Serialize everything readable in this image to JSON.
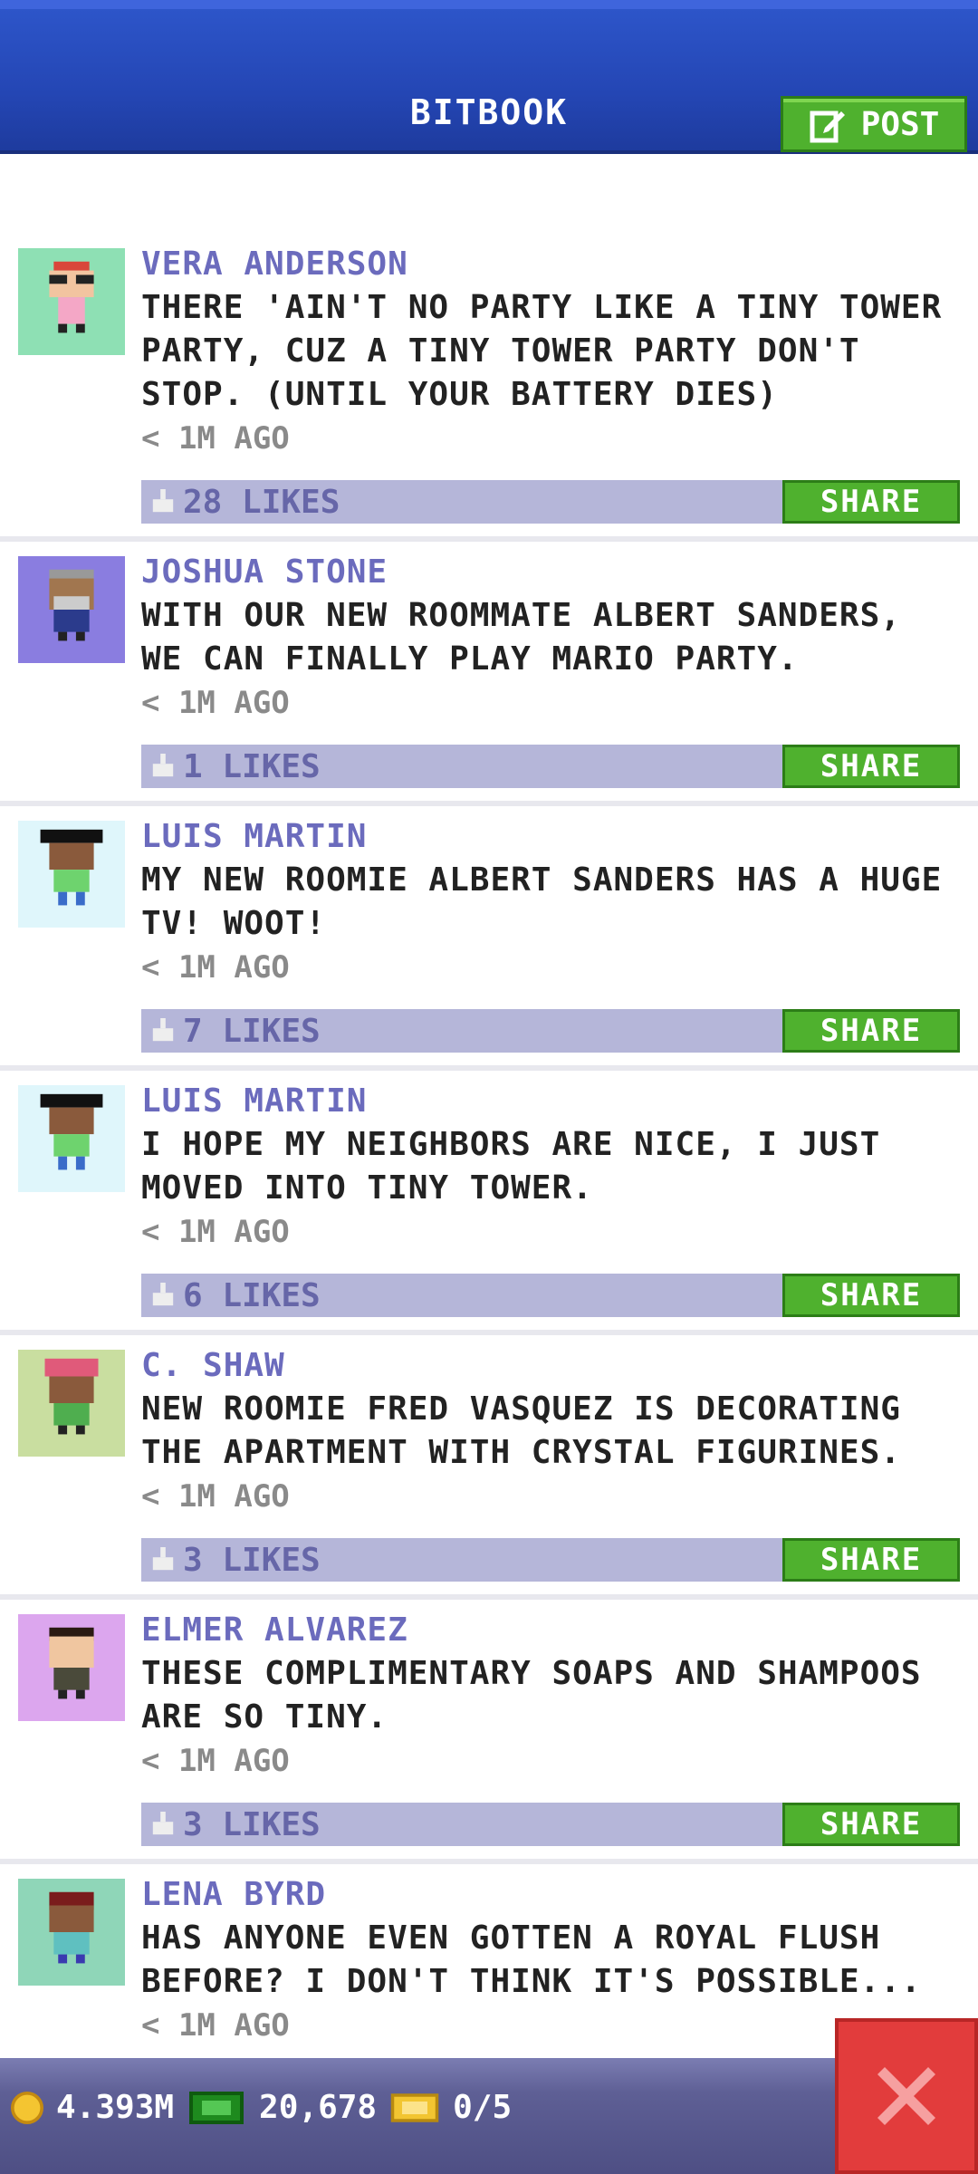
{
  "header": {
    "title": "BITBOOK",
    "post_label": "POST"
  },
  "posts": [
    {
      "author": "VERA ANDERSON",
      "text": "THERE 'AIN'T NO PARTY LIKE A TINY TOWER PARTY, CUZ A TINY TOWER PARTY DON'T STOP. (UNTIL YOUR BATTERY DIES)",
      "time": "< 1M AGO",
      "likes": "28 LIKES",
      "share": "SHARE",
      "avatar_bg": "#8ee0b4"
    },
    {
      "author": "JOSHUA STONE",
      "text": "WITH OUR NEW ROOMMATE ALBERT SANDERS, WE CAN FINALLY PLAY MARIO PARTY.",
      "time": "< 1M AGO",
      "likes": "1 LIKES",
      "share": "SHARE",
      "avatar_bg": "#8a7de0"
    },
    {
      "author": "LUIS MARTIN",
      "text": "MY NEW ROOMIE ALBERT SANDERS HAS A HUGE TV! WOOT!",
      "time": "< 1M AGO",
      "likes": "7 LIKES",
      "share": "SHARE",
      "avatar_bg": "#dff6fb"
    },
    {
      "author": "LUIS MARTIN",
      "text": "I HOPE MY NEIGHBORS ARE NICE, I JUST MOVED INTO TINY TOWER.",
      "time": "< 1M AGO",
      "likes": "6 LIKES",
      "share": "SHARE",
      "avatar_bg": "#dff6fb"
    },
    {
      "author": "C. SHAW",
      "text": "NEW ROOMIE FRED VASQUEZ IS DECORATING THE APARTMENT WITH CRYSTAL FIGURINES.",
      "time": "< 1M AGO",
      "likes": "3 LIKES",
      "share": "SHARE",
      "avatar_bg": "#c9dea0"
    },
    {
      "author": "ELMER ALVAREZ",
      "text": "THESE COMPLIMENTARY SOAPS AND SHAMPOOS ARE SO TINY.",
      "time": "< 1M AGO",
      "likes": "3 LIKES",
      "share": "SHARE",
      "avatar_bg": "#dca6ee"
    },
    {
      "author": "LENA BYRD",
      "text": "HAS ANYONE EVEN GOTTEN A ROYAL FLUSH BEFORE? I DON'T THINK IT'S POSSIBLE...",
      "time": "< 1M AGO",
      "avatar_bg": "#8fd6b8"
    }
  ],
  "status": {
    "coins": "4.393M",
    "bux": "20,678",
    "tickets": "0/5"
  },
  "colors": {
    "accent_green": "#4fb12e",
    "header_blue": "#2446b4",
    "close_red": "#e23c3c",
    "author_purple": "#6b6bbd"
  }
}
